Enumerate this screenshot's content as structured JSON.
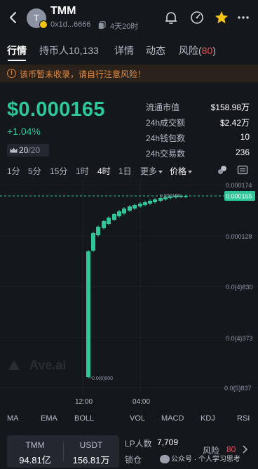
{
  "header": {
    "avatar_letter": "T",
    "token_name": "TMM",
    "address": "0x1d...6666",
    "age": "4天20时",
    "icons": [
      "back-icon",
      "bell-icon",
      "gauge-icon",
      "star-icon",
      "more-icon"
    ]
  },
  "tabs": [
    {
      "label": "行情"
    },
    {
      "label": "持币人10,133"
    },
    {
      "label": "详情"
    },
    {
      "label": "动态"
    },
    {
      "label": "风险",
      "count": "80"
    }
  ],
  "warning": "该币暂未收录，请自行注意风险！",
  "price": {
    "value": "$0.000165",
    "change": "+1.04%",
    "rank": "20",
    "rank_total": "/20"
  },
  "stats": [
    {
      "label": "流通市值",
      "value": "$158.98万"
    },
    {
      "label": "24h成交额",
      "value": "$2.42万"
    },
    {
      "label": "24h钱包数",
      "value": "10"
    },
    {
      "label": "24h交易数",
      "value": "236"
    }
  ],
  "timeframes": [
    "1分",
    "5分",
    "15分",
    "1时",
    "4时",
    "1日",
    "更多",
    "价格"
  ],
  "active_timeframe": "4时",
  "chart_data": {
    "type": "candlestick",
    "y_ticks": [
      "0.000174",
      "0.000128",
      "0.0{4}830",
      "0.0{4}373",
      "0.0{5}837"
    ],
    "x_ticks": [
      "12:00",
      "04:00"
    ],
    "current_price_label": "0.000165",
    "high_marker": "0.000165",
    "low_marker": "0.0{6}800",
    "watermark": "Ave.ai",
    "colors": {
      "up": "#2ec799",
      "down": "#f04e5c"
    }
  },
  "indicators": [
    "MA",
    "EMA",
    "BOLL",
    "VOL",
    "MACD",
    "KDJ",
    "RSI"
  ],
  "bottom": {
    "pair": [
      {
        "symbol": "TMM",
        "amount": "94.81亿"
      },
      {
        "symbol": "USDT",
        "amount": "156.81万"
      }
    ],
    "lp_label": "LP人数",
    "lp_value": "7,709",
    "lock_label": "锁仓",
    "risk_label": "风险",
    "risk_value": "80",
    "watermark": "公众号 · 个人学习思考"
  }
}
